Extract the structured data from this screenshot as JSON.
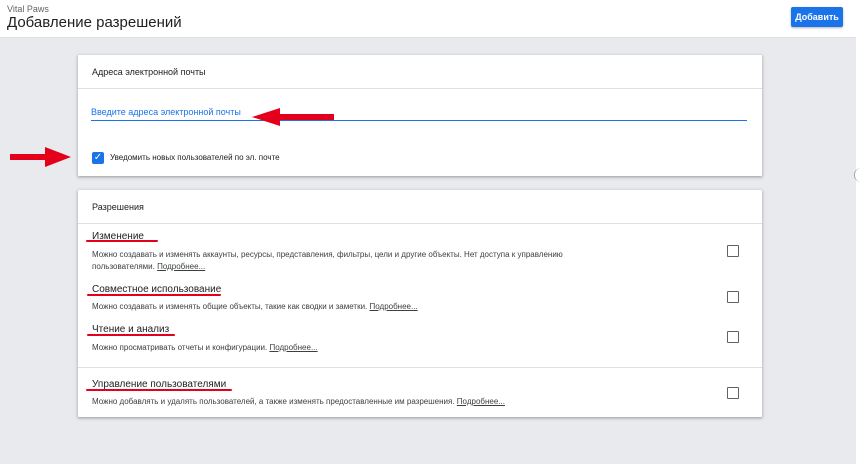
{
  "header": {
    "app_name": "Vital Paws",
    "title": "Добавление разрешений",
    "add_button": "Добавить"
  },
  "email_section": {
    "title": "Адреса электронной почты",
    "input_placeholder": "Введите адреса электронной почты",
    "input_value": "",
    "notify_checked": true,
    "notify_label": "Уведомить новых пользователей по эл. почте"
  },
  "permissions_section": {
    "title": "Разрешения",
    "learn_more": "Подробнее...",
    "items": [
      {
        "title": "Изменение",
        "description_line1": "Можно создавать и изменять аккаунты, ресурсы, представления, фильтры, цели и другие объекты. Нет доступа к управлению",
        "description_line2": "пользователями.",
        "checked": false
      },
      {
        "title": "Совместное использование",
        "description_line1": "Можно создавать и изменять общие объекты, такие как сводки и заметки.",
        "checked": false
      },
      {
        "title": "Чтение и анализ",
        "description_line1": "Можно просматривать отчеты и конфигурации.",
        "checked": false
      },
      {
        "title": "Управление пользователями",
        "description_line1": "Можно добавлять и удалять пользователей, а также изменять предоставленные им разрешения.",
        "checked": false
      }
    ]
  },
  "colors": {
    "accent": "#1a73e8",
    "annotation": "#e4001b",
    "background": "#e8eaed"
  }
}
